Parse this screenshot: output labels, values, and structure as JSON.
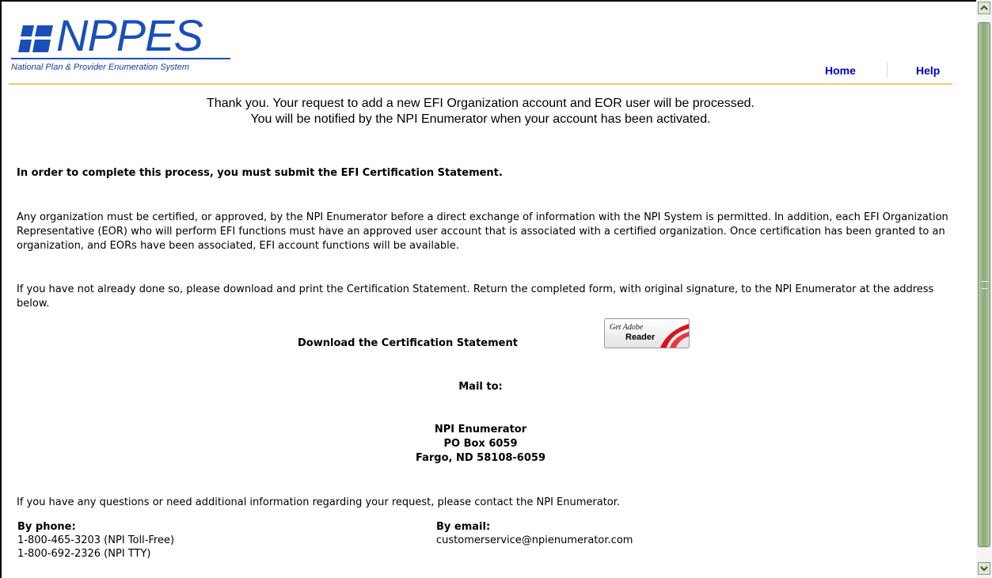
{
  "header": {
    "logo_text": "NPPES",
    "logo_subtitle": "National Plan & Provider Enumeration System",
    "nav": {
      "home": "Home",
      "help": "Help"
    }
  },
  "main": {
    "thanks_line1": "Thank you. Your request to add a new EFI Organization account and EOR user will be processed.",
    "thanks_line2": "You will be notified by the NPI Enumerator when your account has been activated.",
    "cert_notice": "In order to complete this process, you must submit the EFI Certification Statement.",
    "paragraph1": "Any organization must be certified, or approved, by the NPI Enumerator before a direct exchange of information with the NPI System is permitted. In addition, each EFI Organization Representative (EOR) who will perform EFI functions must have an approved user account that is associated with a certified organization. Once certification has been granted to an organization, and EORs have been associated, EFI account functions will be available.",
    "paragraph2": "If you have not already done so, please download and print the Certification Statement. Return the completed form, with original signature, to the NPI Enumerator at the address below.",
    "download_label": "Download the Certification Statement",
    "adobe_button": {
      "line1": "Get Adobe",
      "line2": "Reader"
    },
    "mail_to_label": "Mail to:",
    "address": {
      "name": "NPI Enumerator",
      "po_box": "PO Box 6059",
      "city": "Fargo, ND 58108-6059"
    },
    "questions_text": "If you have any questions or need additional information regarding your request, please contact the NPI Enumerator.",
    "phone": {
      "label": "By phone:",
      "line1": "1-800-465-3203 (NPI Toll-Free)",
      "line2": "1-800-692-2326 (NPI TTY)"
    },
    "email": {
      "label": "By email:",
      "address": "customerservice@npienumerator.com"
    }
  },
  "colors": {
    "brand_blue": "#1a4fb8",
    "nav_link": "#0000cc",
    "header_rule": "#f2cc6a"
  }
}
